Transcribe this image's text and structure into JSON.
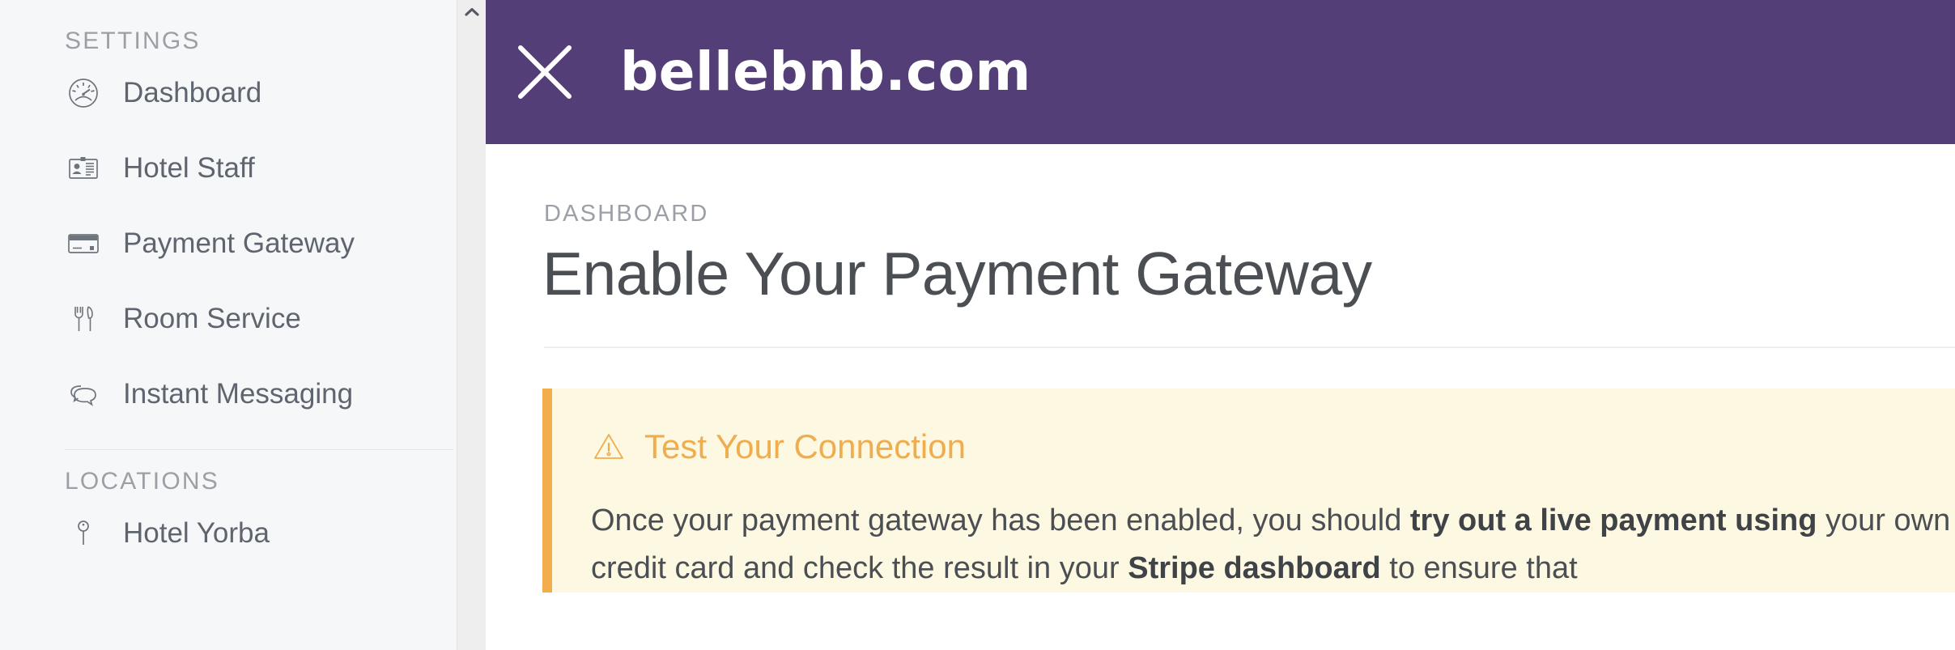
{
  "sidebar": {
    "sections": [
      {
        "label": "SETTINGS",
        "items": [
          {
            "label": "Dashboard",
            "icon": "speedometer-icon"
          },
          {
            "label": "Hotel Staff",
            "icon": "id-card-icon"
          },
          {
            "label": "Payment Gateway",
            "icon": "credit-card-icon"
          },
          {
            "label": "Room Service",
            "icon": "cutlery-icon"
          },
          {
            "label": "Instant Messaging",
            "icon": "chat-bubbles-icon"
          }
        ]
      },
      {
        "label": "LOCATIONS",
        "items": [
          {
            "label": "Hotel Yorba",
            "icon": "map-pin-icon"
          }
        ]
      }
    ]
  },
  "scrollbar": {
    "up_arrow": "chevron-up-icon"
  },
  "topbar": {
    "close_icon": "close-icon",
    "brand": "bellebnb.com",
    "background": "#533E78"
  },
  "main": {
    "breadcrumb": "DASHBOARD",
    "title": "Enable Your Payment Gateway"
  },
  "alert": {
    "icon": "warning-triangle-icon",
    "title": "Test Your Connection",
    "accent": "#F0AD4E",
    "background": "#FDF8E1",
    "body_part_1": "Once your payment gateway has been enabled, you should ",
    "body_strong_1": "try out a live payment using",
    "body_part_2": " your own credit card and check the result in your ",
    "body_strong_2": "Stripe dashboard",
    "body_part_3": " to ensure that"
  }
}
